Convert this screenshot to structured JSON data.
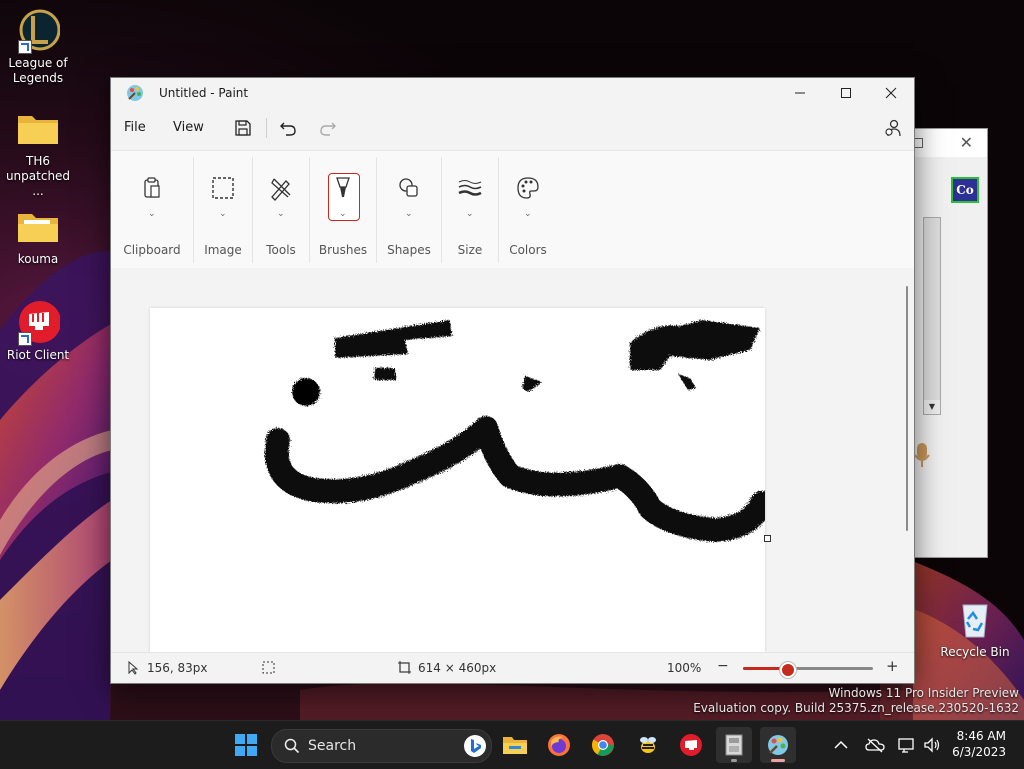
{
  "desktop": {
    "icons": [
      {
        "label": "League of Legends",
        "icon": "league-of-legends-icon"
      },
      {
        "label": "TH6 unpatched ...",
        "icon": "folder-icon"
      },
      {
        "label": "kouma",
        "icon": "folder-icon"
      },
      {
        "label": "Riot Client",
        "icon": "riot-client-icon"
      },
      {
        "label": "Recycle Bin",
        "icon": "recycle-bin-icon"
      }
    ],
    "watermark": {
      "line1": "Windows 11 Pro Insider Preview",
      "line2": "Evaluation copy. Build 25375.zn_release.230520-1632"
    }
  },
  "background_window": {
    "badge": "Co"
  },
  "paint": {
    "title": "Untitled - Paint",
    "menu": {
      "file": "File",
      "view": "View"
    },
    "ribbon": {
      "groups": [
        {
          "label": "Clipboard",
          "icon": "clipboard-icon"
        },
        {
          "label": "Image",
          "icon": "selection-icon"
        },
        {
          "label": "Tools",
          "icon": "tools-icon"
        },
        {
          "label": "Brushes",
          "icon": "brush-icon"
        },
        {
          "label": "Shapes",
          "icon": "shapes-icon"
        },
        {
          "label": "Size",
          "icon": "size-icon"
        },
        {
          "label": "Colors",
          "icon": "palette-icon"
        }
      ],
      "selected_group": "Brushes"
    },
    "status": {
      "cursor_position": "156, 83px",
      "canvas_size": "614 × 460px",
      "zoom": "100%",
      "zoom_fraction": 0.33
    }
  },
  "taskbar": {
    "search_label": "Search",
    "apps": [
      "start-icon",
      "file-explorer-icon",
      "firefox-icon",
      "chrome-icon",
      "bee-app-icon",
      "riot-client-icon",
      "archive-icon",
      "paint-icon"
    ],
    "clock": {
      "time": "8:46 AM",
      "date": "6/3/2023"
    }
  }
}
